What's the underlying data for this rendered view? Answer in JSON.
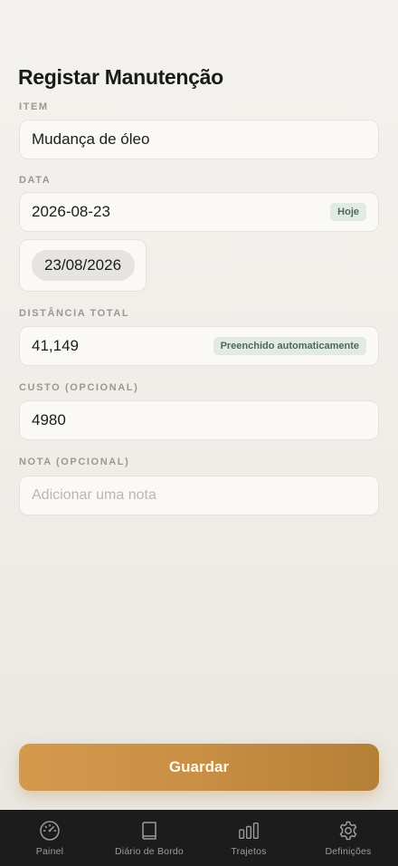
{
  "page": {
    "title": "Registar Manutenção"
  },
  "form": {
    "item": {
      "label": "ITEM",
      "value": "Mudança de óleo"
    },
    "date": {
      "label": "DATA",
      "value": "2026-08-23",
      "badge": "Hoje",
      "picker_value": "23/08/2026"
    },
    "distance": {
      "label": "DISTÂNCIA TOTAL",
      "value": "41,149",
      "badge": "Preenchido automaticamente"
    },
    "cost": {
      "label": "CUSTO (OPCIONAL)",
      "value": "4980"
    },
    "note": {
      "label": "NOTA (OPCIONAL)",
      "value": "",
      "placeholder": "Adicionar uma nota"
    }
  },
  "actions": {
    "save_label": "Guardar"
  },
  "tab_bar": {
    "items": [
      {
        "label": "Painel",
        "icon": "speedometer-icon"
      },
      {
        "label": "Diário de Bordo",
        "icon": "book-icon"
      },
      {
        "label": "Trajetos",
        "icon": "bar-chart-icon"
      },
      {
        "label": "Definições",
        "icon": "gear-icon"
      }
    ]
  },
  "colors": {
    "accent": "#c88f45",
    "tab_bar_background": "#1c1c1c",
    "badge_background": "#e3e9e3",
    "badge_text": "#4a6b59"
  }
}
